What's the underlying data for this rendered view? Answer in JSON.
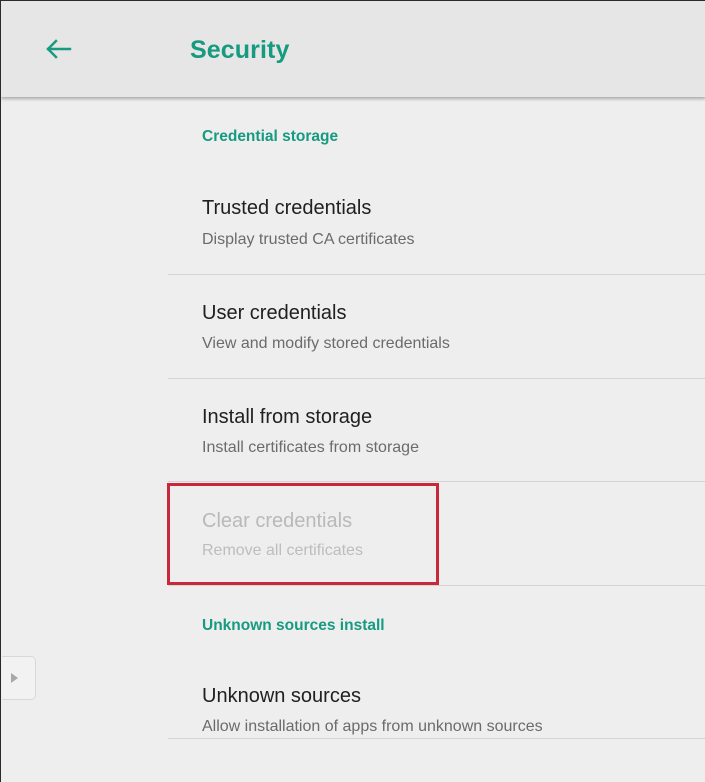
{
  "header": {
    "title": "Security",
    "back_icon": "arrow-back-icon"
  },
  "colors": {
    "accent": "#169a80",
    "app_bar_bg": "#e6e6e6",
    "content_bg": "#eeeeee",
    "highlight": "#c8283a"
  },
  "sections": [
    {
      "header": "Credential storage",
      "items": [
        {
          "title": "Trusted credentials",
          "summary": "Display trusted CA certificates",
          "enabled": true
        },
        {
          "title": "User credentials",
          "summary": "View and modify stored credentials",
          "enabled": true
        },
        {
          "title": "Install from storage",
          "summary": "Install certificates from storage",
          "enabled": true
        },
        {
          "title": "Clear credentials",
          "summary": "Remove all certificates",
          "enabled": false,
          "highlighted": true
        }
      ]
    },
    {
      "header": "Unknown sources install",
      "items": [
        {
          "title": "Unknown sources",
          "summary": "Allow installation of apps from unknown sources",
          "enabled": true
        }
      ]
    }
  ],
  "side_handle": {
    "icon": "triangle-right-icon"
  }
}
